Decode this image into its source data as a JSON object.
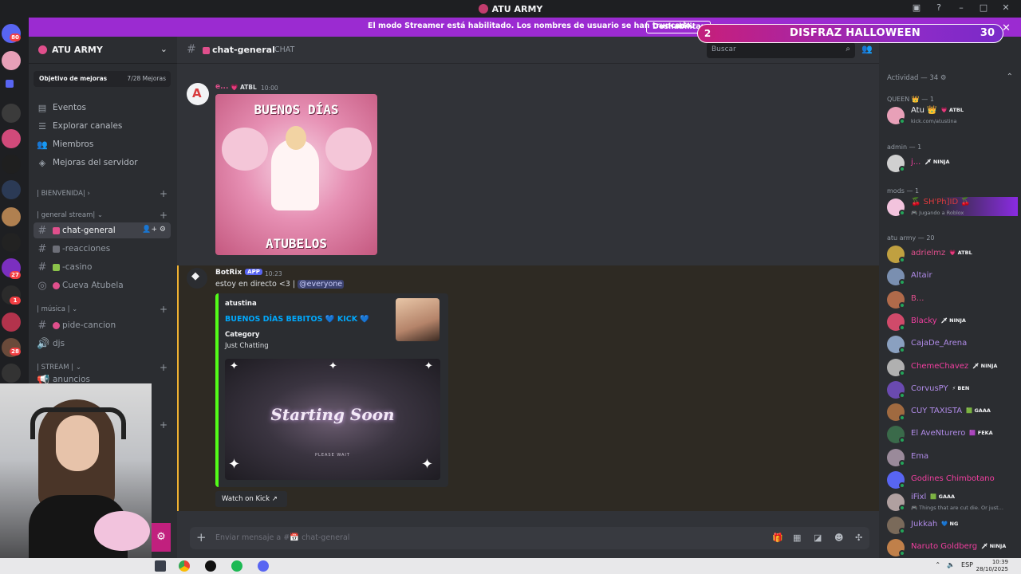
{
  "window": {
    "title": "ATU ARMY"
  },
  "banner": {
    "text": "El modo Streamer está habilitado. Los nombres de usuario se han truncado.",
    "button": "Deshabilitar"
  },
  "overlay": {
    "badge": "2",
    "title": "DISFRAZ HALLOWEEN",
    "count": "30",
    "close": "✕"
  },
  "guilds": {
    "badges": [
      "80",
      "27",
      "1",
      "28"
    ]
  },
  "server": {
    "name": "ATU ARMY",
    "boost_label": "Objetivo de mejoras",
    "boost_value": "7/28 Mejoras",
    "nav": [
      "Eventos",
      "Explorar canales",
      "Miembros",
      "Mejoras del servidor"
    ],
    "categories": [
      "| BIENVENIDA|",
      "| general stream|",
      "| música |",
      "| STREAM |"
    ],
    "channels": [
      "chat-general",
      "-reacciones",
      "-casino",
      "Cueva Atubela",
      "pide-cancion",
      "djs",
      "anuncios"
    ]
  },
  "channel": {
    "name": "chat-general",
    "topic": "CHAT",
    "search_placeholder": "Buscar"
  },
  "messages": {
    "first_user": "e...",
    "first_tag": "ATBL",
    "first_time": "10:00",
    "gif_top": "BUENOS DÍAS",
    "gif_bottom": "ATUBELOS",
    "bot_user": "BotRix",
    "bot_tag": "APP",
    "bot_time": "10:23",
    "bot_text": "estoy en directo <3 |",
    "mention": "@everyone",
    "embed_author": "atustina",
    "embed_title": "BUENOS DÍAS BEBITOS 💙 KICK 💙",
    "embed_field_name": "Category",
    "embed_field_value": "Just Chatting",
    "embed_image_text": "Starting Soon",
    "embed_image_sub": "PLEASE WAIT",
    "watch_button": "Watch on Kick"
  },
  "composer": {
    "placeholder": "Enviar mensaje a #📅 chat-general"
  },
  "members": {
    "activity": "Actividad — 34",
    "groups": [
      {
        "label": "QUEEN 👑 — 1",
        "items": [
          {
            "name": "Atu 👑",
            "tag": "💗 ATBL",
            "sub": "kick.com/atustina",
            "color": "#f2f3f5"
          }
        ]
      },
      {
        "label": "admin — 1",
        "items": [
          {
            "name": "j...",
            "tag": "🗡 NINJA",
            "sub": "",
            "color": "#f23fa0"
          }
        ]
      },
      {
        "label": "mods — 1",
        "items": [
          {
            "name": "🍒 SH'Ph]ID 🍒",
            "tag": "",
            "sub": "🎮 Jugando a Roblox",
            "color": "#e03a3e"
          }
        ]
      },
      {
        "label": "atu army — 20",
        "items": [
          {
            "name": "adrielmz",
            "tag": "💗 ATBL",
            "sub": "",
            "color": "#e04f8c"
          },
          {
            "name": "Altair",
            "tag": "",
            "sub": "",
            "color": "#b08be8"
          },
          {
            "name": "B...",
            "tag": "",
            "sub": "",
            "color": "#e04f8c"
          },
          {
            "name": "Blacky",
            "tag": "🗡 NINJA",
            "sub": "",
            "color": "#f23fa0"
          },
          {
            "name": "CajaDe_Arena",
            "tag": "",
            "sub": "",
            "color": "#b08be8"
          },
          {
            "name": "ChemeChavez",
            "tag": "🗡 NINJA",
            "sub": "",
            "color": "#f23fa0"
          },
          {
            "name": "CorvusPY",
            "tag": "⚡ BEN",
            "sub": "",
            "color": "#b08be8"
          },
          {
            "name": "CUY TAXISTA",
            "tag": "🟩 GAAA",
            "sub": "",
            "color": "#b08be8"
          },
          {
            "name": "El AveNturero",
            "tag": "🟪 FEKA",
            "sub": "",
            "color": "#b08be8"
          },
          {
            "name": "Ema",
            "tag": "",
            "sub": "",
            "color": "#b08be8"
          },
          {
            "name": "Godines Chimbotano",
            "tag": "",
            "sub": "",
            "color": "#f23fa0"
          },
          {
            "name": "iFixl",
            "tag": "🟩 GAAA",
            "sub": "🎮 Things that are cut die. Or just...",
            "color": "#b08be8"
          },
          {
            "name": "Jukkah",
            "tag": "💙 NG",
            "sub": "",
            "color": "#b08be8"
          },
          {
            "name": "Naruto Goldberg",
            "tag": "🗡 NINJA",
            "sub": "",
            "color": "#f23fa0"
          }
        ]
      }
    ]
  },
  "taskbar": {
    "lang": "ESP",
    "time": "10:39",
    "date": "28/10/2025"
  }
}
